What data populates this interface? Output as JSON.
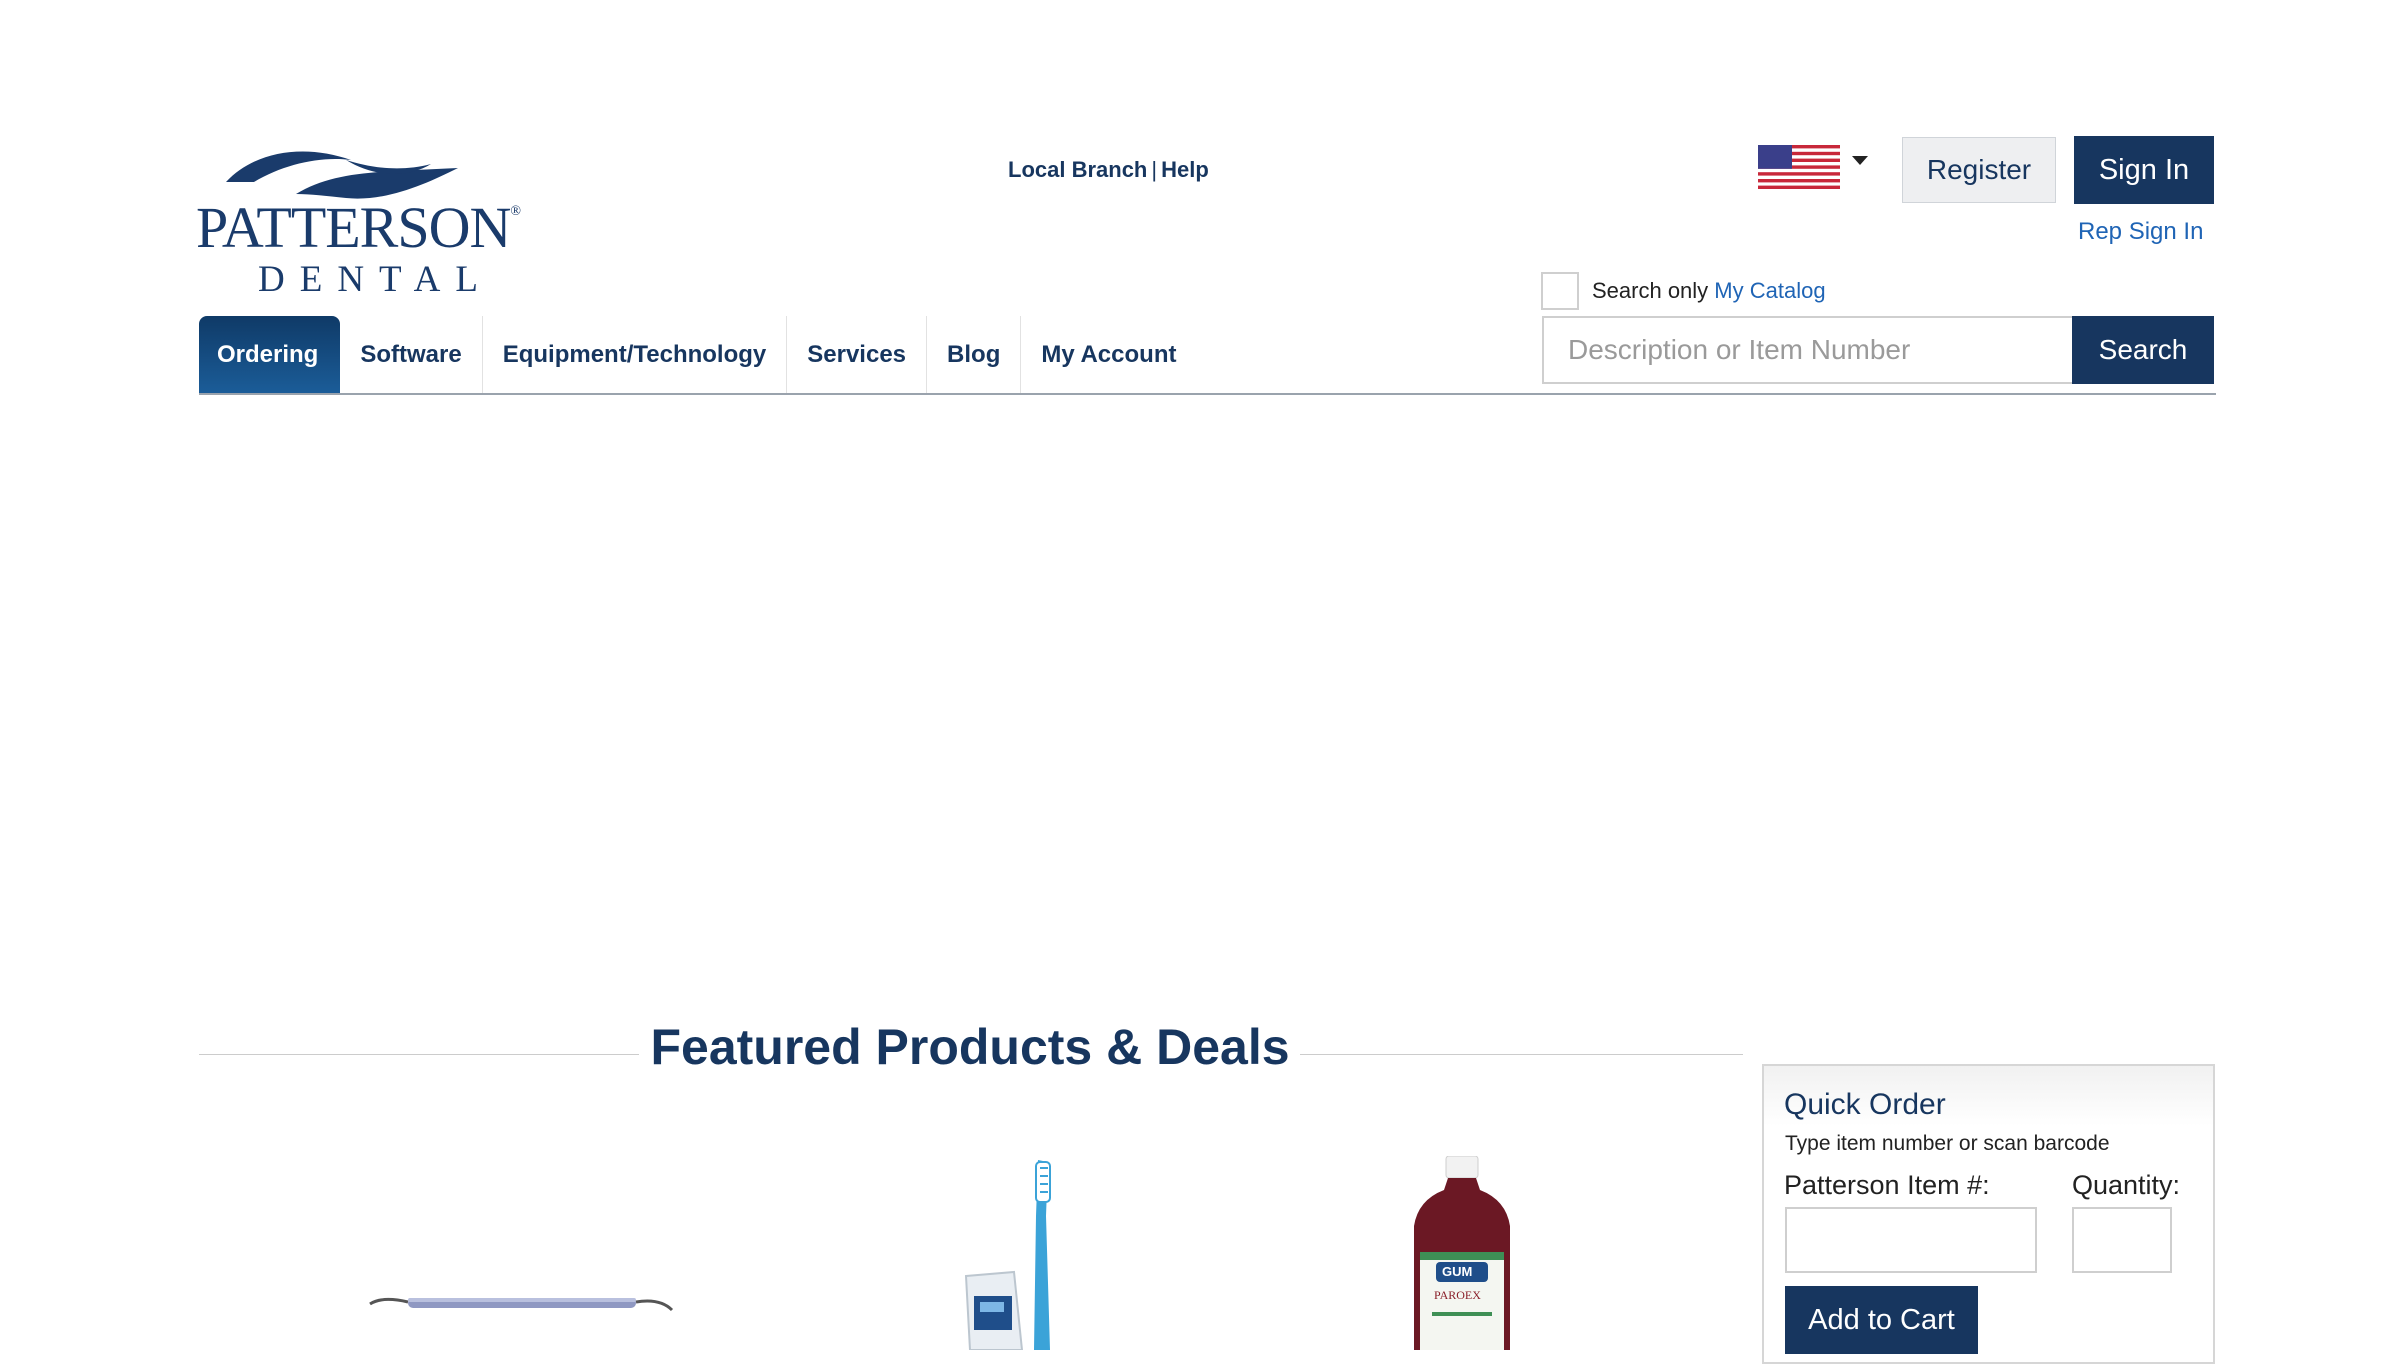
{
  "brand": {
    "name": "PATTERSON",
    "registered_mark": "®",
    "sub": "DENTAL",
    "color": "#1a3b6b"
  },
  "utility_links": {
    "local_branch": "Local Branch",
    "separator": "|",
    "help": "Help"
  },
  "locale": {
    "flag_icon": "us-flag-icon",
    "caret_icon": "caret-down-icon"
  },
  "account": {
    "register": "Register",
    "sign_in": "Sign In",
    "rep_sign_in": "Rep Sign In"
  },
  "search": {
    "catalog_prefix": "Search only ",
    "catalog_link": "My Catalog",
    "catalog_checked": false,
    "placeholder": "Description or Item Number",
    "value": "",
    "button": "Search"
  },
  "nav": {
    "tabs": [
      {
        "label": "Ordering",
        "active": true
      },
      {
        "label": "Software",
        "active": false
      },
      {
        "label": "Equipment/Technology",
        "active": false
      },
      {
        "label": "Services",
        "active": false
      },
      {
        "label": "Blog",
        "active": false
      },
      {
        "label": "My Account",
        "active": false
      }
    ]
  },
  "featured": {
    "title": "Featured Products & Deals",
    "products": [
      {
        "image": "dental-instrument-image"
      },
      {
        "image": "toothbrush-toothpaste-image"
      },
      {
        "image": "gum-paroex-rinse-image",
        "label_text": "GUM",
        "label_sub": "PAROEX"
      }
    ]
  },
  "quick_order": {
    "title": "Quick Order",
    "subtitle": "Type item number or scan barcode",
    "item_label": "Patterson Item #:",
    "qty_label": "Quantity:",
    "item_value": "",
    "qty_value": "",
    "add_button": "Add to Cart"
  },
  "colors": {
    "primary": "#17365f",
    "link": "#1f64b5",
    "active_tab_top": "#0f3a67",
    "active_tab_bottom": "#1b5d99"
  }
}
